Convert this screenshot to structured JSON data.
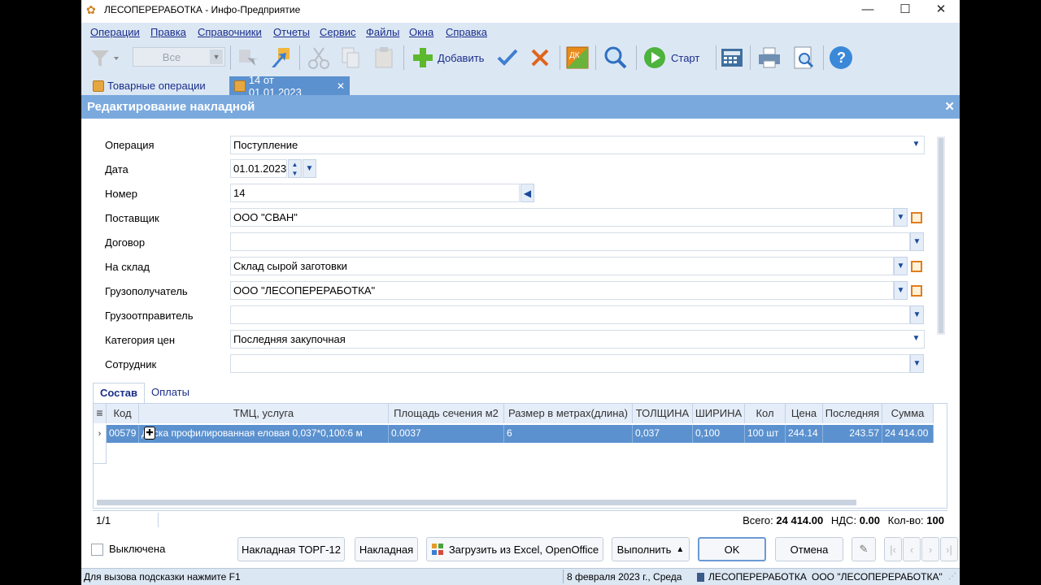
{
  "window": {
    "title": "ЛЕСОПЕРЕРАБОТКА - Инфо-Предприятие"
  },
  "menu": [
    "Операции",
    "Правка",
    "Справочники",
    "Отчеты",
    "Сервис",
    "Файлы",
    "Окна",
    "Справка"
  ],
  "toolbar": {
    "filter_value": "Все",
    "add_label": "Добавить",
    "start_label": "Старт",
    "dk_label": "ДК"
  },
  "tabs": [
    {
      "label": "Товарные операции"
    },
    {
      "label": "14 от 01.01.2023"
    }
  ],
  "panel": {
    "title": "Редактирование накладной"
  },
  "form": {
    "operation": {
      "label": "Операция",
      "value": "Поступление"
    },
    "date": {
      "label": "Дата",
      "value": "01.01.2023"
    },
    "number": {
      "label": "Номер",
      "value": "14"
    },
    "supplier": {
      "label": "Поставщик",
      "value": "ООО \"СВАН\""
    },
    "contract": {
      "label": "Договор",
      "value": ""
    },
    "warehouse": {
      "label": "На склад",
      "value": "Склад сырой заготовки"
    },
    "consignee": {
      "label": "Грузополучатель",
      "value": "ООО \"ЛЕСОПЕРЕРАБОТКА\""
    },
    "shipper": {
      "label": "Грузоотправитель",
      "value": ""
    },
    "price_category": {
      "label": "Категория цен",
      "value": "Последняя закупочная"
    },
    "employee": {
      "label": "Сотрудник",
      "value": ""
    }
  },
  "subtabs": [
    "Состав",
    "Оплаты"
  ],
  "grid": {
    "columns": [
      "Код",
      "ТМЦ, услуга",
      "Площадь сечения м2",
      "Размер в метрах(длина)",
      "ТОЛЩИНА",
      "ШИРИНА",
      "Кол",
      "Цена",
      "Последняя",
      "Сумма"
    ],
    "rows": [
      {
        "code": "00579",
        "item": "Доска профилированная еловая 0,037*0,100:6 м",
        "area": "0.0037",
        "length": "6",
        "thickness": "0,037",
        "width": "0,100",
        "qty": "100 шт",
        "price": "244.14",
        "last": "243.57",
        "sum": "24 414.00"
      }
    ]
  },
  "grid_status": {
    "page": "1/1",
    "total_label": "Всего:",
    "total": "24 414.00",
    "vat_label": "НДС:",
    "vat": "0.00",
    "count_label": "Кол-во:",
    "count": "100"
  },
  "bottom": {
    "disabled_label": "Выключена",
    "torg12": "Накладная ТОРГ-12",
    "invoice": "Накладная",
    "load_excel": "Загрузить из Excel, OpenOffice",
    "execute": "Выполнить",
    "ok": "OK",
    "cancel": "Отмена"
  },
  "statusbar": {
    "hint": "Для вызова подсказки нажмите F1",
    "date": "8 февраля 2023 г., Среда",
    "db": "ЛЕСОПЕРЕРАБОТКА",
    "org": "ООО \"ЛЕСОПЕРЕРАБОТКА\""
  }
}
